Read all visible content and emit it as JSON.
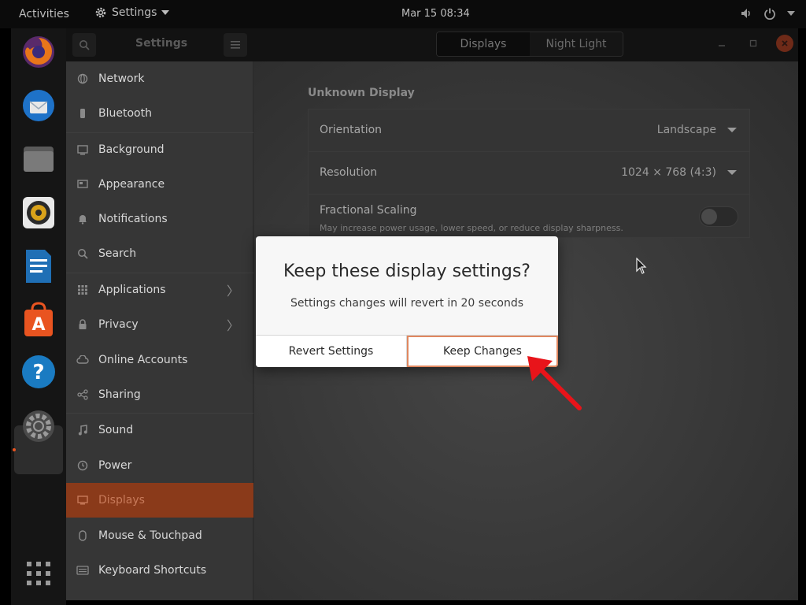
{
  "topbar": {
    "activities": "Activities",
    "app_name": "Settings",
    "clock": "Mar 15  08:34",
    "tray_icons": [
      "volume-icon",
      "power-icon",
      "chevron-down-icon"
    ]
  },
  "dock": {
    "apps": [
      "firefox",
      "thunderbird",
      "files",
      "rhythmbox",
      "writer",
      "software",
      "help",
      "settings",
      "show-apps"
    ],
    "active_app": "settings"
  },
  "window": {
    "title": "Settings",
    "tabs": [
      {
        "label": "Displays",
        "active": true
      },
      {
        "label": "Night Light",
        "active": false
      }
    ]
  },
  "sidebar": {
    "items": [
      {
        "label": "Network",
        "icon": "network-icon"
      },
      {
        "label": "Bluetooth",
        "icon": "bluetooth-icon"
      },
      {
        "label": "Background",
        "icon": "background-icon"
      },
      {
        "label": "Appearance",
        "icon": "appearance-icon"
      },
      {
        "label": "Notifications",
        "icon": "bell-icon"
      },
      {
        "label": "Search",
        "icon": "search-icon"
      },
      {
        "label": "Applications",
        "icon": "apps-grid-icon",
        "has_submenu": true
      },
      {
        "label": "Privacy",
        "icon": "lock-icon",
        "has_submenu": true
      },
      {
        "label": "Online Accounts",
        "icon": "cloud-icon"
      },
      {
        "label": "Sharing",
        "icon": "share-icon"
      },
      {
        "label": "Sound",
        "icon": "music-note-icon"
      },
      {
        "label": "Power",
        "icon": "power-icon"
      },
      {
        "label": "Displays",
        "icon": "display-icon",
        "selected": true
      },
      {
        "label": "Mouse & Touchpad",
        "icon": "mouse-icon"
      },
      {
        "label": "Keyboard Shortcuts",
        "icon": "keyboard-icon"
      }
    ]
  },
  "main": {
    "display_name": "Unknown Display",
    "orientation": {
      "label": "Orientation",
      "value": "Landscape"
    },
    "resolution": {
      "label": "Resolution",
      "value": "1024 × 768 (4:3)"
    },
    "fractional_scaling": {
      "label": "Fractional Scaling",
      "description": "May increase power usage, lower speed, or reduce display sharpness.",
      "enabled": false
    }
  },
  "dialog": {
    "title": "Keep these display settings?",
    "message": "Settings changes will revert in 20 seconds",
    "revert_label": "Revert Settings",
    "keep_label": "Keep Changes",
    "countdown_seconds": 20
  },
  "colors": {
    "accent": "#e95420",
    "annotation_arrow": "#e8141a",
    "keep_button_border": "#e0875f"
  }
}
